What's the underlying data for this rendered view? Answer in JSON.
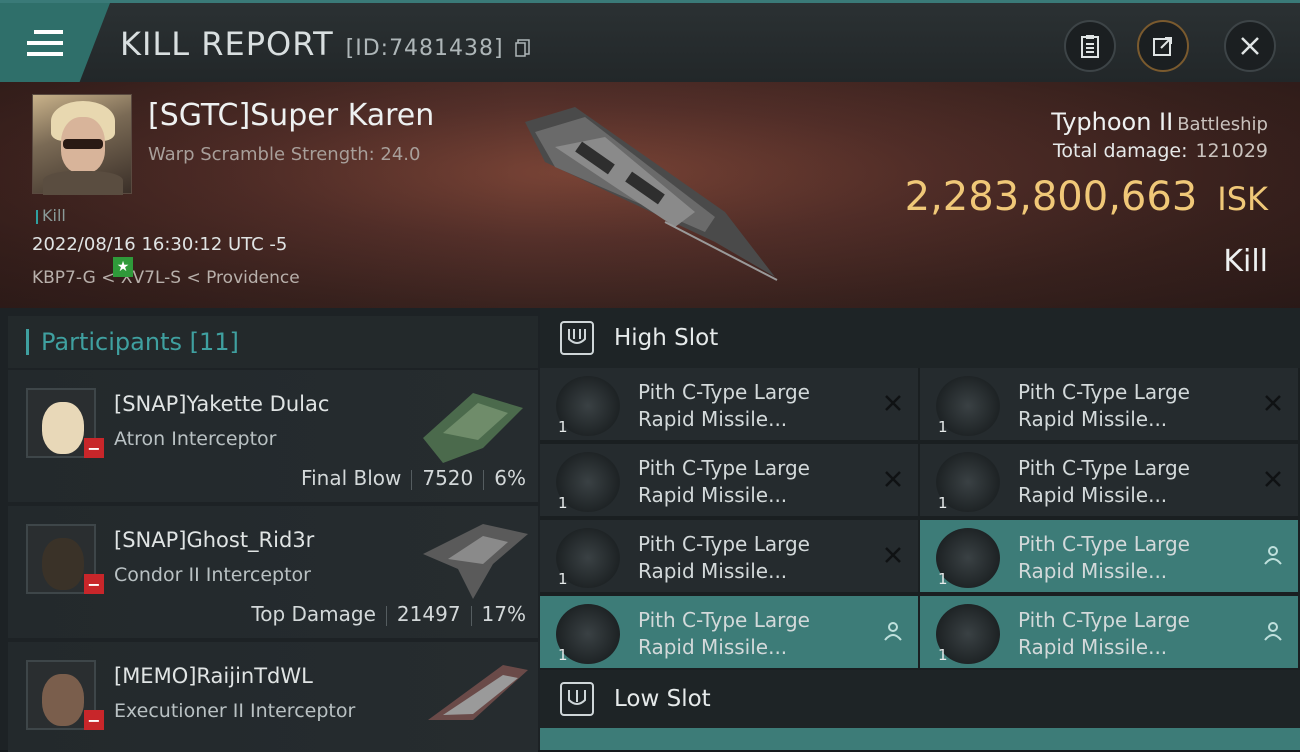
{
  "header": {
    "title": "KILL REPORT",
    "id_text": "[ID:7481438]"
  },
  "victim": {
    "name": "[SGTC]Super Karen",
    "subtitle": "Warp Scramble Strength: 24.0",
    "tag": "Kill",
    "datetime": "2022/08/16 16:30:12 UTC -5",
    "route": "KBP7-G < XV7L-S < Providence",
    "ship": "Typhoon II",
    "ship_class": "Battleship",
    "total_damage_label": "Total damage:",
    "total_damage": "121029",
    "isk_value": "2,283,800,663",
    "isk_unit": "ISK",
    "result": "Kill"
  },
  "participants": {
    "title": "Participants [11]",
    "rows": [
      {
        "name": "[SNAP]Yakette Dulac",
        "ship": "Atron Interceptor",
        "label": "Final Blow",
        "damage": "7520",
        "pct": "6%"
      },
      {
        "name": "[SNAP]Ghost_Rid3r",
        "ship": "Condor II Interceptor",
        "label": "Top Damage",
        "damage": "21497",
        "pct": "17%"
      },
      {
        "name": "[MEMO]RaijinTdWL",
        "ship": "Executioner II Interceptor"
      }
    ]
  },
  "slots": {
    "high": "High Slot",
    "low": "Low Slot",
    "module_line1": "Pith C-Type Large",
    "module_line2": "Rapid Missile...",
    "qty": "1"
  },
  "colors": {
    "accent": "#3d7c78",
    "isk": "#f0c878",
    "danger": "#c8262a"
  }
}
